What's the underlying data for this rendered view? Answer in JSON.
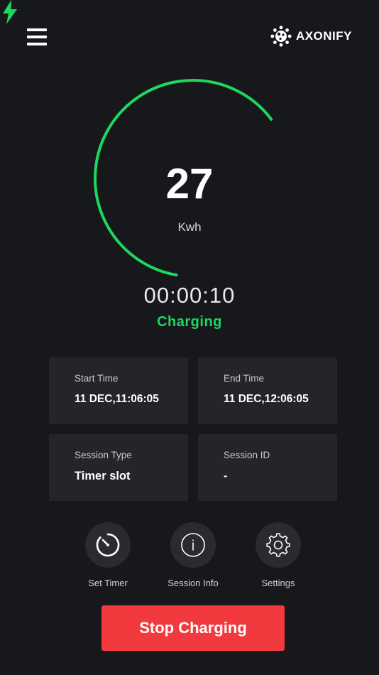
{
  "header": {
    "menu_icon": "hamburger-menu-icon",
    "brand_icon": "axonify-logo-icon",
    "brand_name": "AXONIFY"
  },
  "gauge": {
    "energy_value": "27",
    "energy_unit": "Kwh",
    "progress_fraction": 0.62,
    "accent_color": "#1fd65f",
    "icon": "lightning-bolt-icon"
  },
  "session": {
    "elapsed": "00:00:10",
    "status": "Charging"
  },
  "cards": {
    "start_time": {
      "label": "Start Time",
      "value": "11 DEC,11:06:05"
    },
    "end_time": {
      "label": "End Time",
      "value": "11 DEC,12:06:05"
    },
    "session_type": {
      "label": "Session Type",
      "value": "Timer slot"
    },
    "session_id": {
      "label": "Session ID",
      "value": "-"
    }
  },
  "actions": {
    "set_timer": {
      "label": "Set Timer",
      "icon": "stopwatch-icon"
    },
    "session_info": {
      "label": "Session Info",
      "icon": "info-icon"
    },
    "settings": {
      "label": "Settings",
      "icon": "gear-icon"
    }
  },
  "stop_button": {
    "label": "Stop Charging",
    "color": "#f2393e"
  }
}
